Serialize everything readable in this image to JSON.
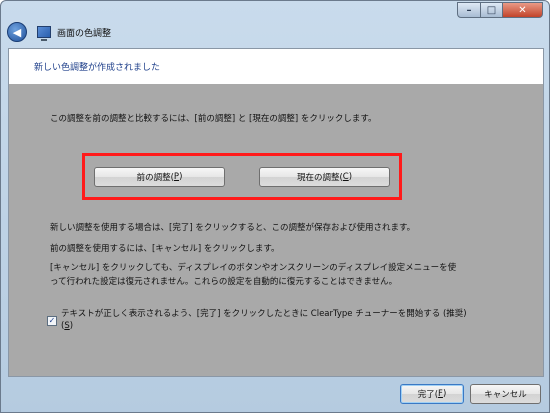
{
  "window": {
    "title": "画面の色調整",
    "caption": {
      "minimize": "–",
      "maximize": "□",
      "close": "✕"
    }
  },
  "nav": {
    "back_glyph": "◀"
  },
  "header": {
    "heading": "新しい色調整が作成されました"
  },
  "body": {
    "instruction": "この調整を前の調整と比較するには、[前の調整] と [現在の調整] をクリックします。",
    "previous_button": {
      "label": "前の調整(",
      "mnemonic": "P",
      "suffix": ")"
    },
    "current_button": {
      "label": "現在の調整(",
      "mnemonic": "C",
      "suffix": ")"
    },
    "finish_note": "新しい調整を使用する場合は、[完了] をクリックすると、この調整が保存および使用されます。",
    "cancel_note": "前の調整を使用するには、[キャンセル] をクリックします。",
    "warning_line1": "[キャンセル] をクリックしても、ディスプレイのボタンやオンスクリーンのディスプレイ設定メニューを使",
    "warning_line2": "って行われた設定は復元されません。これらの設定を自動的に復元することはできません。"
  },
  "cleartype": {
    "checked": true,
    "check_glyph": "✓",
    "label_line1": "テキストが正しく表示されるよう、[完了] をクリックしたときに ClearType チューナーを開始する (推奨)",
    "label_line2_open": "(",
    "label_mnemonic": "S",
    "label_line2_close": ")"
  },
  "footer": {
    "finish_label": "完了(",
    "finish_mnemonic": "F",
    "finish_suffix": ")",
    "cancel_label": "キャンセル"
  },
  "colors": {
    "highlight_box": "#ff1a1a",
    "content_bg": "#a9a9a9",
    "heading_text": "#1e3f8a"
  }
}
